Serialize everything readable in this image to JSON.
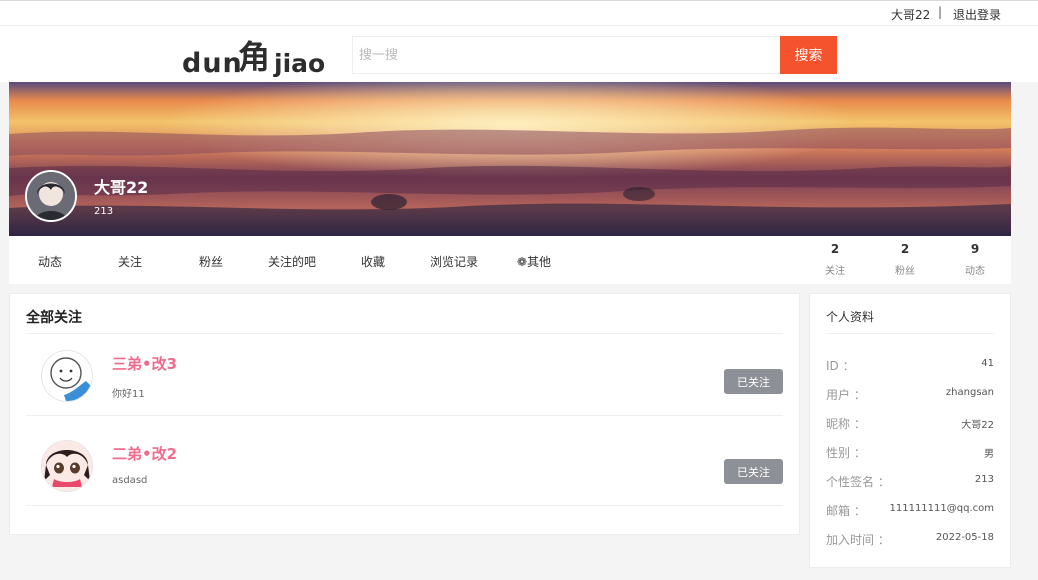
{
  "topbar": {
    "username": "大哥22",
    "separator": "|",
    "logout": "退出登录"
  },
  "header": {
    "logo_text": "dun角jiao",
    "search_placeholder": "搜一搜",
    "search_button": "搜索",
    "colors": {
      "accent": "#f4532d"
    }
  },
  "profile": {
    "name": "大哥22",
    "signature": "213",
    "avatar_icon": "user-avatar"
  },
  "nav": {
    "items": [
      {
        "label": "动态"
      },
      {
        "label": "关注"
      },
      {
        "label": "粉丝"
      },
      {
        "label": "关注的吧"
      },
      {
        "label": "收藏"
      },
      {
        "label": "浏览记录"
      },
      {
        "label": "❁其他"
      }
    ],
    "stats": [
      {
        "value": "2",
        "label": "关注"
      },
      {
        "value": "2",
        "label": "粉丝"
      },
      {
        "value": "9",
        "label": "动态"
      }
    ]
  },
  "follows": {
    "title": "全部关注",
    "items": [
      {
        "name": "三弟•改3",
        "signature": "你好11",
        "button": "已关注"
      },
      {
        "name": "二弟•改2",
        "signature": "asdasd",
        "button": "已关注"
      }
    ],
    "colors": {
      "name": "#f06c8c",
      "button": "#8e9097"
    }
  },
  "info": {
    "title": "个人资料",
    "rows": [
      {
        "key": "ID ：",
        "value": "41"
      },
      {
        "key": "用户 ：",
        "value": "zhangsan"
      },
      {
        "key": "昵称 ：",
        "value": "大哥22"
      },
      {
        "key": "性别 ：",
        "value": "男"
      },
      {
        "key": "个性签名 ：",
        "value": "213"
      },
      {
        "key": "邮箱 ：",
        "value": "111111111@qq.com"
      },
      {
        "key": "加入时间 ：",
        "value": "2022-05-18"
      }
    ]
  }
}
